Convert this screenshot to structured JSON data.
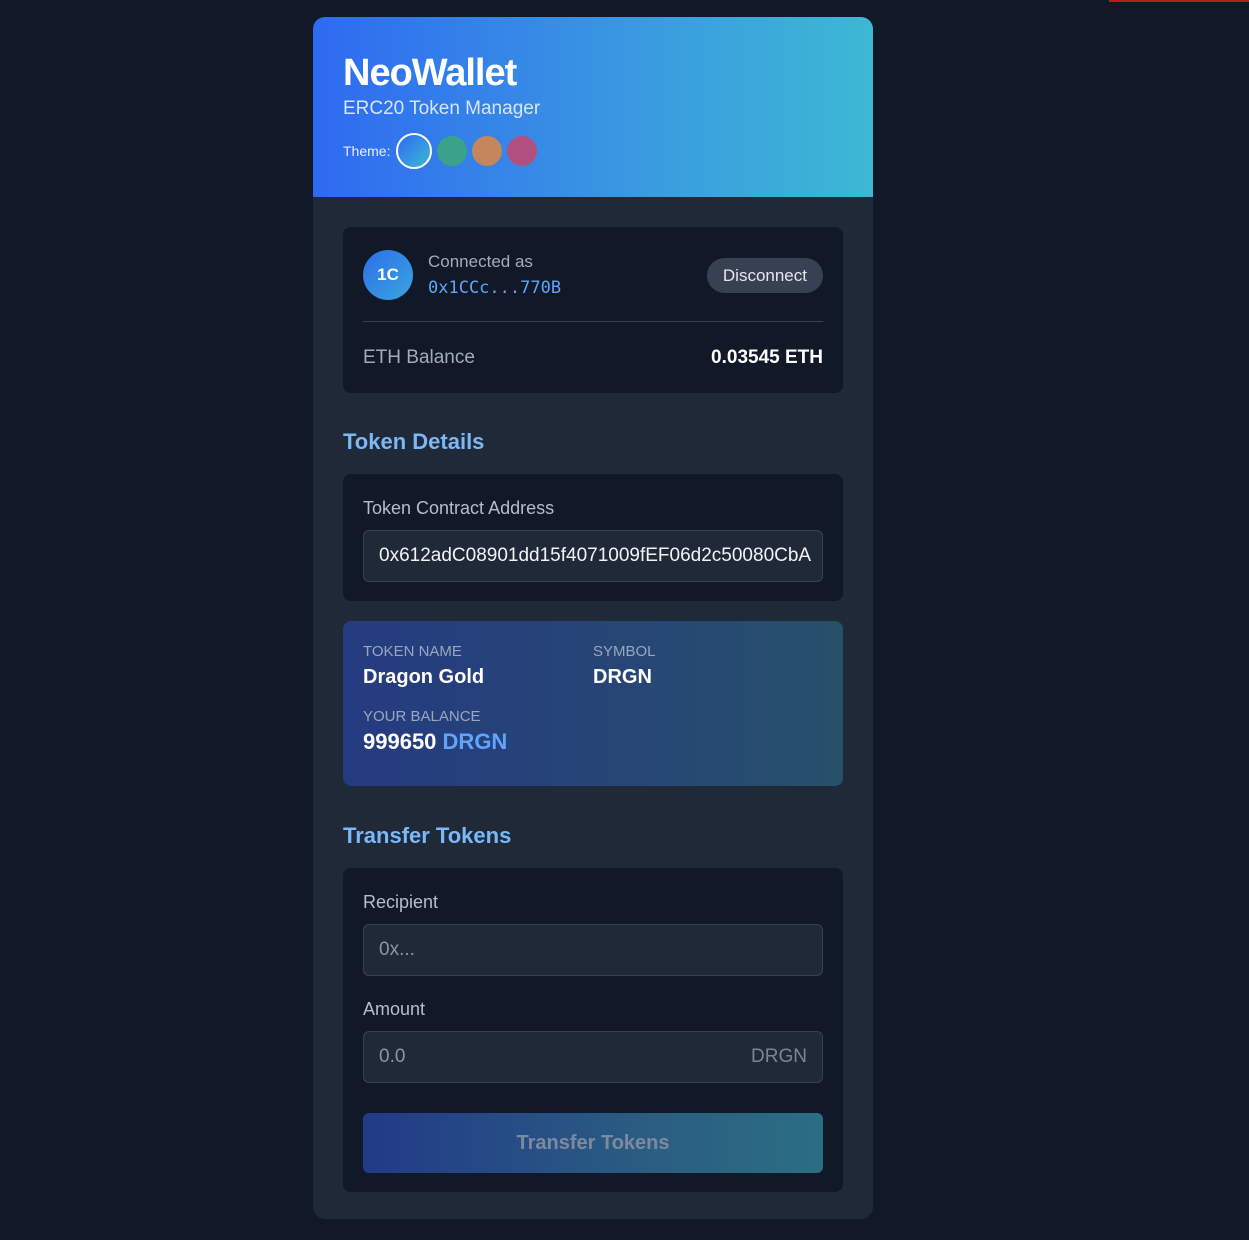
{
  "app": {
    "title": "NeoWallet",
    "subtitle": "ERC20 Token Manager",
    "theme_label": "Theme:",
    "themes": [
      {
        "name": "blue",
        "active": true,
        "color": "#2f6af2"
      },
      {
        "name": "teal",
        "active": false,
        "color": "#3aa28a"
      },
      {
        "name": "amber",
        "active": false,
        "color": "#c4865a"
      },
      {
        "name": "rose",
        "active": false,
        "color": "#b1507f"
      }
    ]
  },
  "account": {
    "avatar_initials": "1C",
    "connected_label": "Connected as",
    "address": "0x1CCc...770B",
    "disconnect_label": "Disconnect",
    "eth_balance_label": "ETH Balance",
    "eth_balance_value": "0.03545 ETH"
  },
  "token_details": {
    "section_title": "Token Details",
    "contract_label": "Token Contract Address",
    "contract_value": "0x612adC08901dd15f4071009fEF06d2c50080CbA"
  },
  "token_info": {
    "name_label": "TOKEN NAME",
    "name_value": "Dragon Gold",
    "symbol_label": "SYMBOL",
    "symbol_value": "DRGN",
    "balance_label": "YOUR BALANCE",
    "balance_amount": "999650",
    "balance_symbol": "DRGN"
  },
  "transfer": {
    "section_title": "Transfer Tokens",
    "recipient_label": "Recipient",
    "recipient_placeholder": "0x...",
    "amount_label": "Amount",
    "amount_placeholder": "0.0",
    "amount_suffix": "DRGN",
    "button_label": "Transfer Tokens"
  },
  "colors": {
    "page_bg": "#111827",
    "card_bg": "#1f2937",
    "accent": "#60a5fa",
    "section_title": "#7cb7f7"
  }
}
